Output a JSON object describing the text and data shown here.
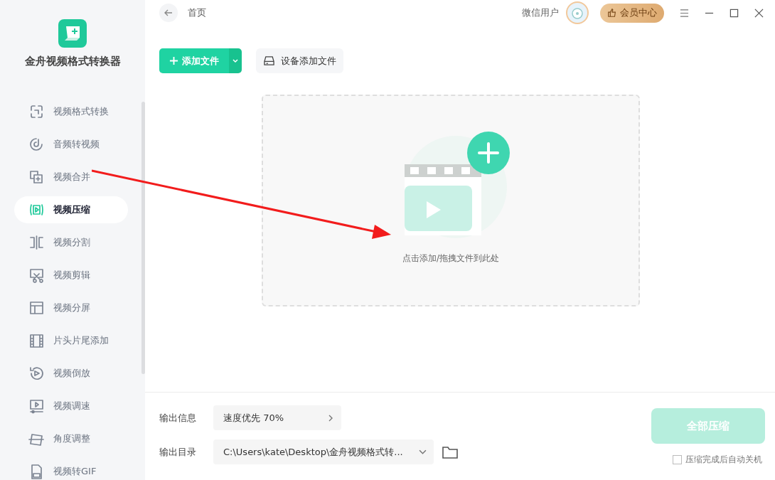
{
  "app": {
    "name": "金舟视频格式转换器"
  },
  "sidebar": {
    "items": [
      {
        "label": "视频格式转换",
        "selected": false
      },
      {
        "label": "音频转视频",
        "selected": false
      },
      {
        "label": "视频合并",
        "selected": false
      },
      {
        "label": "视频压缩",
        "selected": true
      },
      {
        "label": "视频分割",
        "selected": false
      },
      {
        "label": "视频剪辑",
        "selected": false
      },
      {
        "label": "视频分屏",
        "selected": false
      },
      {
        "label": "片头片尾添加",
        "selected": false
      },
      {
        "label": "视频倒放",
        "selected": false
      },
      {
        "label": "视频调速",
        "selected": false
      },
      {
        "label": "角度调整",
        "selected": false
      },
      {
        "label": "视频转GIF",
        "selected": false
      }
    ]
  },
  "header": {
    "breadcrumb": "首页",
    "user_name": "微信用户",
    "vip_button": "会员中心"
  },
  "toolbar": {
    "add_button": "添加文件",
    "device_button": "设备添加文件"
  },
  "drop_zone": {
    "hint": "点击添加/拖拽文件到此处"
  },
  "output": {
    "info_label": "输出信息",
    "info_value": "速度优先 70%",
    "dir_label": "输出目录",
    "dir_value": "C:\\Users\\kate\\Desktop\\金舟视频格式转..."
  },
  "start_button": {
    "label": "全部压缩",
    "disabled": true
  },
  "shutdown_option": {
    "label": "压缩完成后自动关机",
    "checked": false
  }
}
